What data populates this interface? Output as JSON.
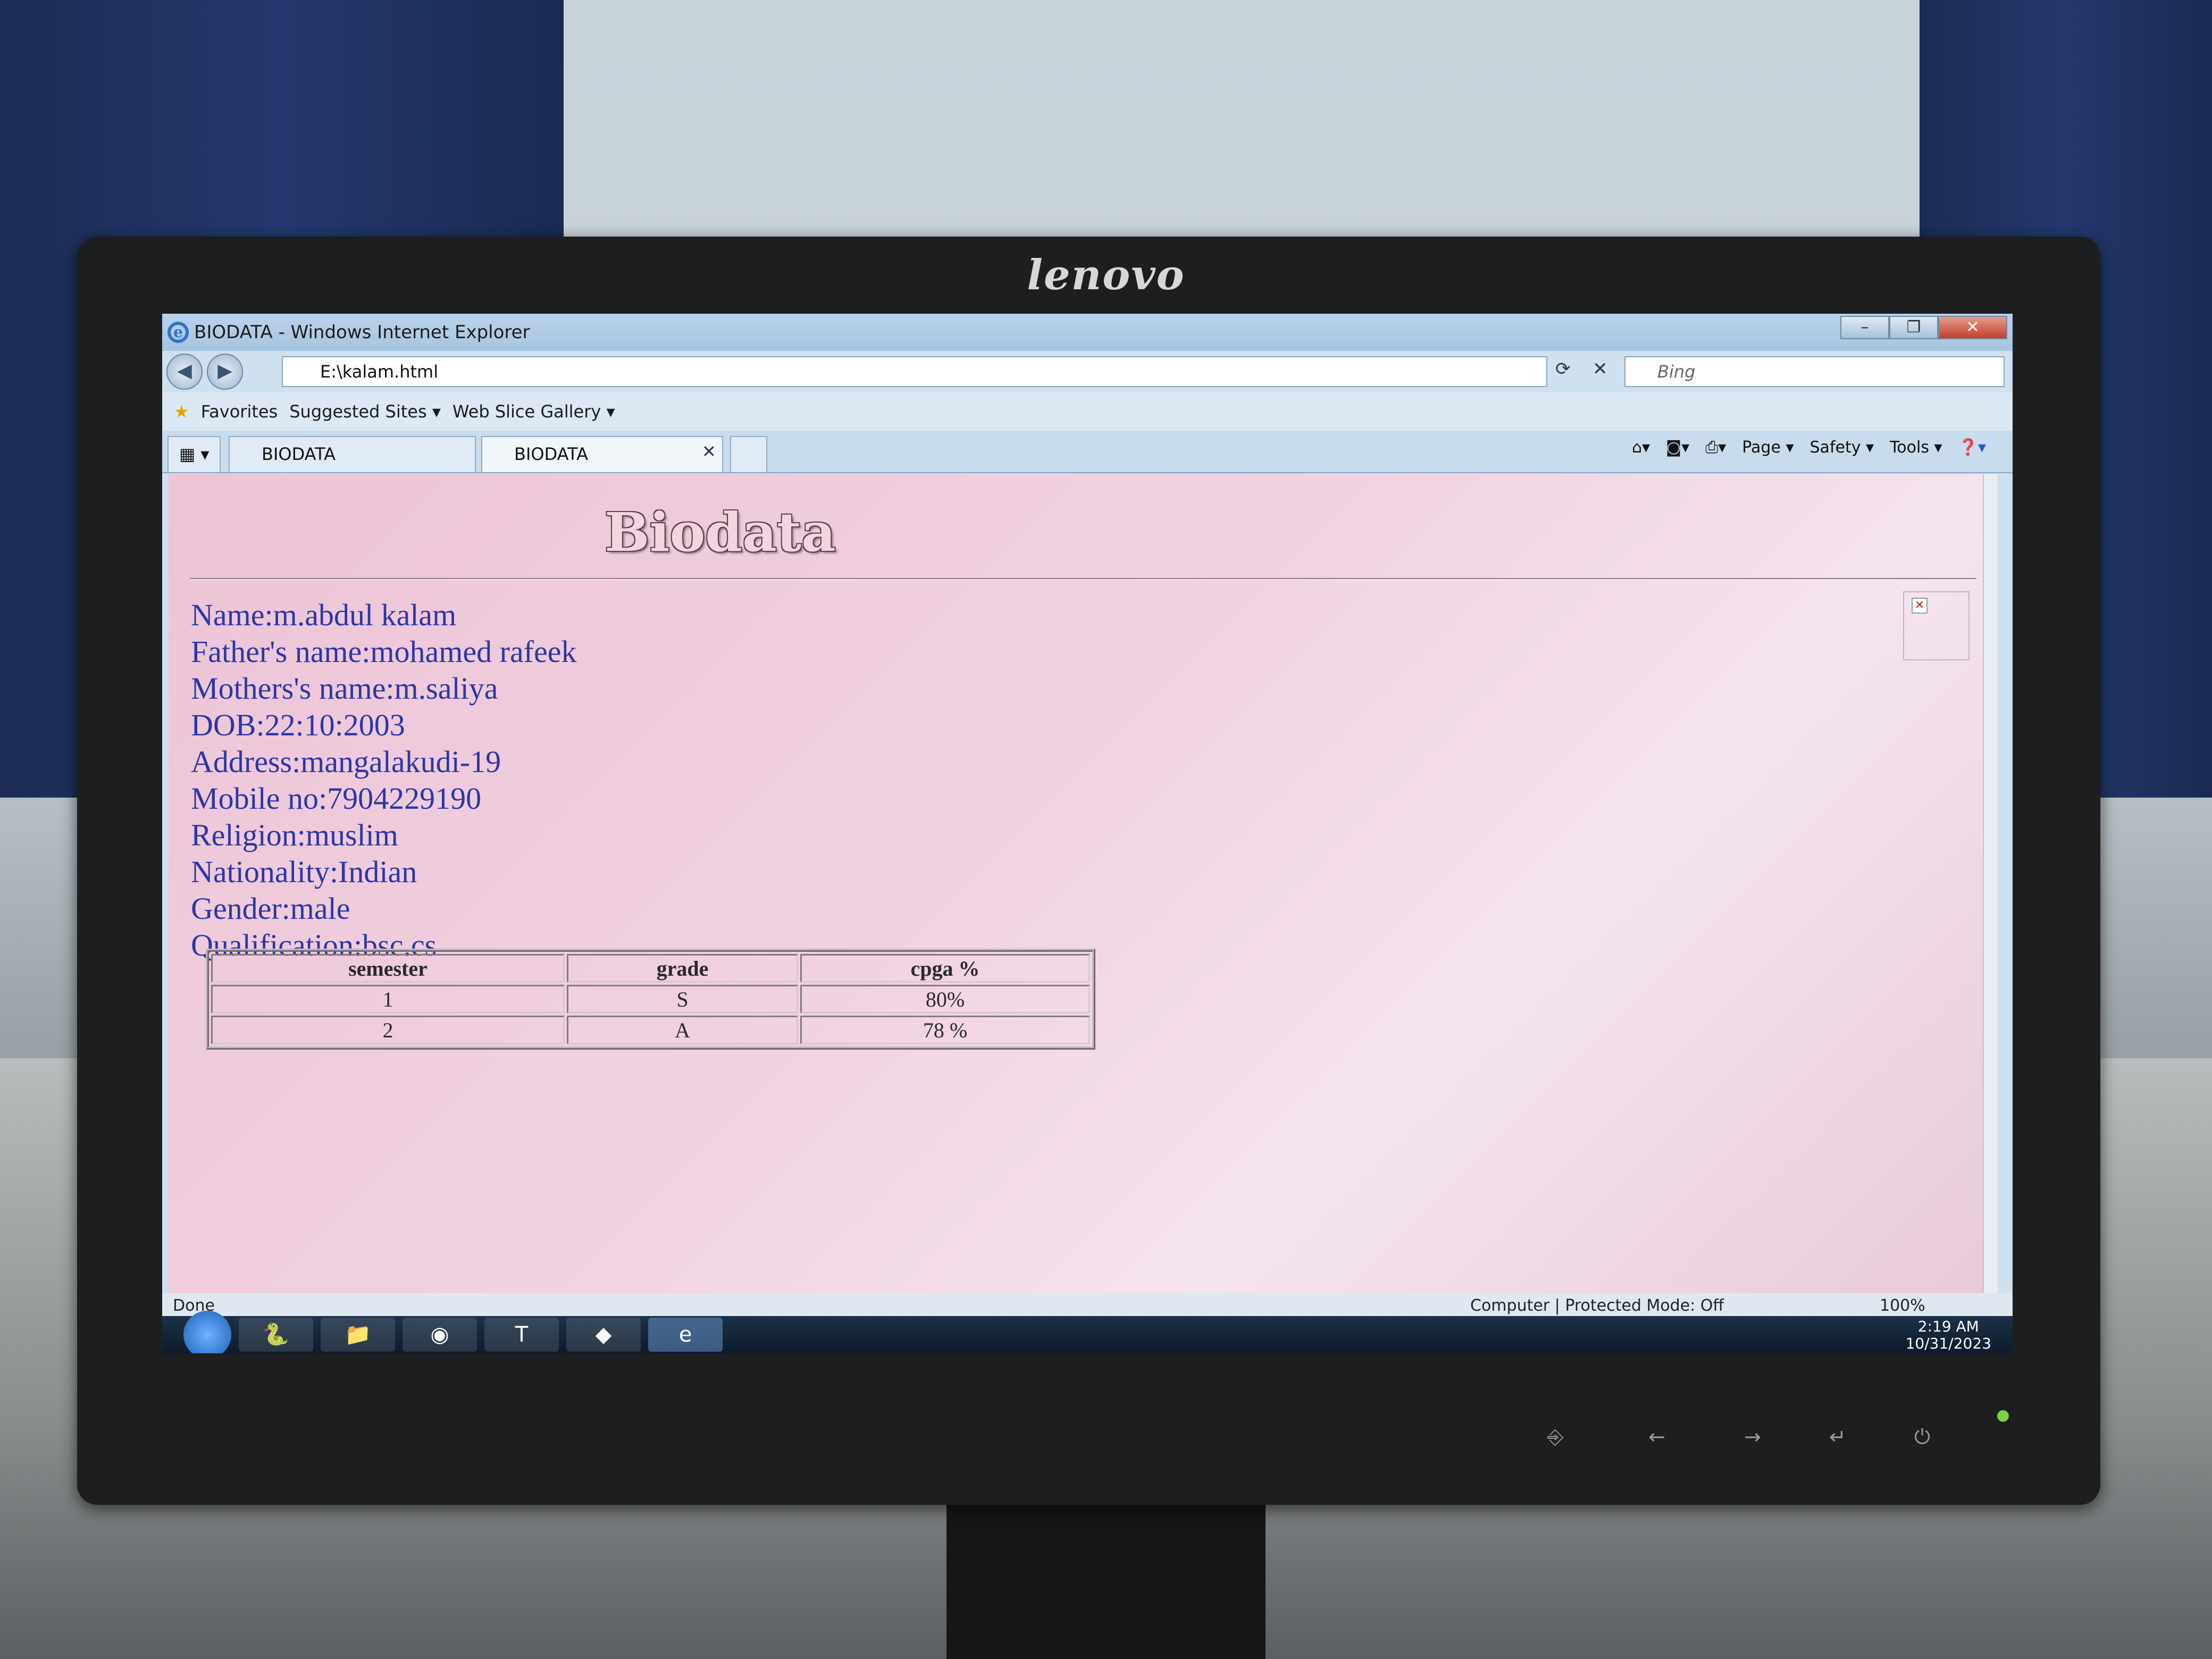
{
  "window": {
    "title": "BIODATA - Windows Internet Explorer"
  },
  "nav": {
    "address": "E:\\kalam.html",
    "search_placeholder": "Bing"
  },
  "favorites_bar": {
    "favorites": "Favorites",
    "suggested": "Suggested Sites ▾",
    "webslice": "Web Slice Gallery ▾"
  },
  "tabs": [
    {
      "label": "BIODATA"
    },
    {
      "label": "BIODATA"
    }
  ],
  "command_bar": {
    "page": "Page ▾",
    "safety": "Safety ▾",
    "tools": "Tools ▾"
  },
  "page": {
    "heading": "Biodata",
    "fields": [
      "Name:m.abdul kalam",
      "Father's name:mohamed rafeek",
      "Mothers's name:m.saliya",
      "DOB:22:10:2003",
      "Address:mangalakudi-19",
      "Mobile no:7904229190",
      "Religion:muslim",
      "Nationality:Indian",
      "Gender:male",
      "Qualification:bsc.cs"
    ],
    "table": {
      "headers": [
        "semester",
        "grade",
        "cpga %"
      ],
      "rows": [
        [
          "1",
          "S",
          "80%"
        ],
        [
          "2",
          "A",
          "78 %"
        ]
      ]
    }
  },
  "status": {
    "left": "Done",
    "zone": "Computer | Protected Mode: Off",
    "zoom": "100%"
  },
  "clock": {
    "time": "2:19 AM",
    "date": "10/31/2023"
  },
  "monitor": {
    "brand": "lenovo"
  }
}
